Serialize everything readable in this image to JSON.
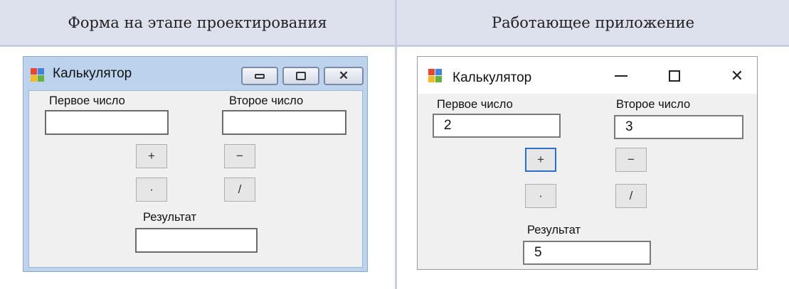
{
  "headers": {
    "left": "Форма на этапе проектирования",
    "right": "Работающее приложение"
  },
  "design_window": {
    "title": "Калькулятор",
    "first_label": "Первое число",
    "second_label": "Второе число",
    "first_value": "",
    "second_value": "",
    "buttons": [
      "+",
      "−",
      "·",
      "/"
    ],
    "result_label": "Результат",
    "result_value": ""
  },
  "running_window": {
    "title": "Калькулятор",
    "caption_minimize": "–",
    "caption_maximize": "□",
    "caption_close": "✕",
    "first_label": "Первое число",
    "second_label": "Второе число",
    "first_value": "2",
    "second_value": "3",
    "buttons": [
      "+",
      "−",
      "·",
      "/"
    ],
    "result_label": "Результат",
    "result_value": "5"
  },
  "colors": {
    "header_bg": "#dde1ee",
    "grid_line": "#c9cde0",
    "design_window_border": "#a9c2e3",
    "form_bg": "#f0f0f0",
    "focus_border": "#2a6fc9"
  }
}
